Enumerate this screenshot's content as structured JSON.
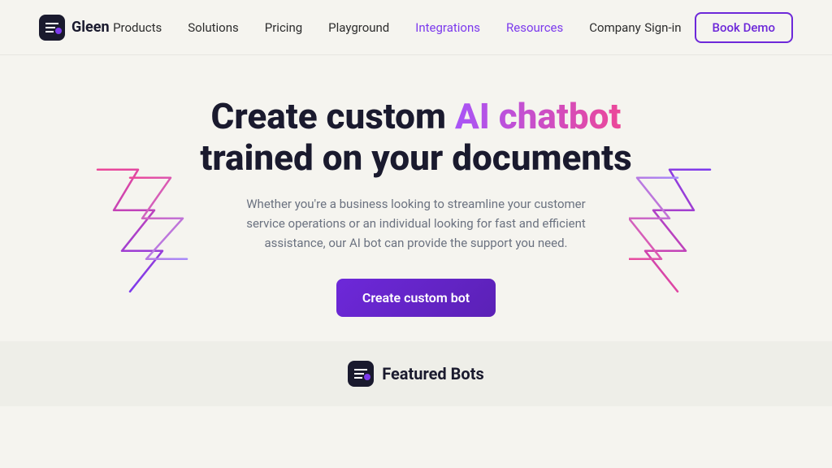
{
  "nav": {
    "logo_text": "Gleen",
    "links": [
      {
        "label": "Products",
        "active": false
      },
      {
        "label": "Solutions",
        "active": false
      },
      {
        "label": "Pricing",
        "active": false
      },
      {
        "label": "Playground",
        "active": false
      },
      {
        "label": "Integrations",
        "active": true
      },
      {
        "label": "Resources",
        "active": true
      },
      {
        "label": "Company",
        "active": false
      }
    ],
    "signin_label": "Sign-in",
    "book_demo_label": "Book Demo"
  },
  "hero": {
    "title_part1": "Create custom ",
    "title_highlight": "AI chatbot",
    "title_part2": "trained on your documents",
    "subtitle": "Whether you're a business looking to streamline your customer service operations or an individual looking for fast and efficient assistance, our AI bot can provide the support you need.",
    "cta_label": "Create custom bot"
  },
  "bottom": {
    "featured_label": "Featured Bots"
  }
}
